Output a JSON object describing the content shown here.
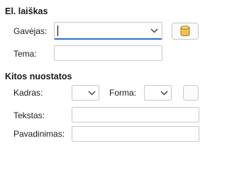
{
  "email": {
    "section_title": "El. laiškas",
    "recipient_label": "Gavėjas:",
    "recipient_value": "",
    "subject_label": "Tema:",
    "subject_value": ""
  },
  "other": {
    "section_title": "Kitos nuostatos",
    "frame_label": "Kadras:",
    "frame_value": "",
    "form_label": "Forma:",
    "form_value": "",
    "text_label": "Tekstas:",
    "text_value": "",
    "name_label": "Pavadinimas:",
    "name_value": ""
  },
  "icons": {
    "address_book": "database-icon",
    "dropdown": "chevron-down-icon"
  },
  "colors": {
    "focus_accent": "#2f6fbf",
    "database_icon": "#f2c14e"
  }
}
